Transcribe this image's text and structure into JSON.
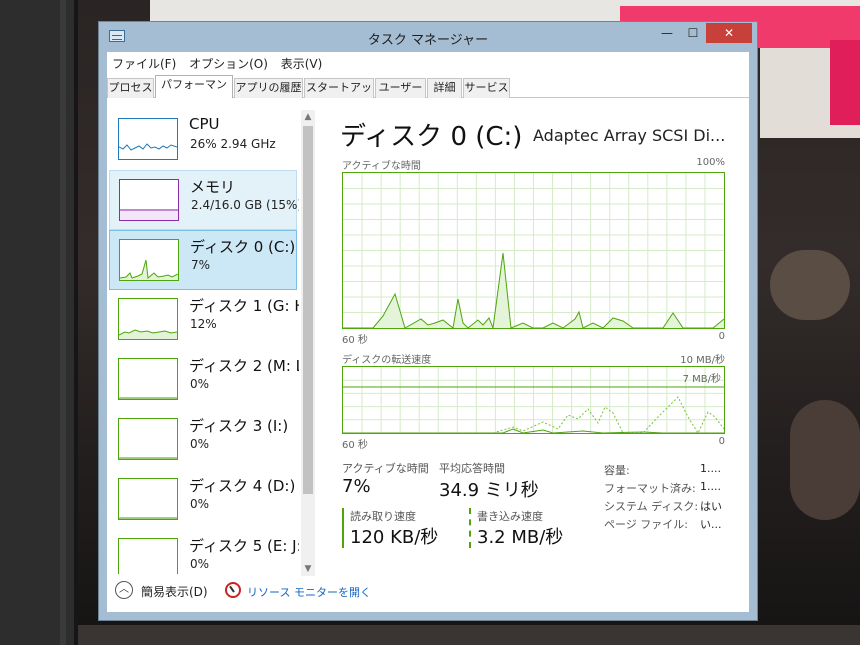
{
  "window": {
    "title": "タスク マネージャー",
    "controls": {
      "minimize": "—",
      "maximize": "☐",
      "close": "✕"
    }
  },
  "menu": [
    "ファイル(F)",
    "オプション(O)",
    "表示(V)"
  ],
  "tabs": [
    "プロセス",
    "パフォーマンス",
    "アプリの履歴",
    "スタートアップ",
    "ユーザー",
    "詳細",
    "サービス"
  ],
  "active_tab": "パフォーマンス",
  "sidebar": {
    "items": [
      {
        "name": "CPU",
        "value": "26% 2.94 GHz",
        "color": "#1e7ab7",
        "state": "normal"
      },
      {
        "name": "メモリ",
        "value": "2.4/16.0 GB (15%)",
        "color": "#8b2da8",
        "state": "hover"
      },
      {
        "name": "ディスク 0 (C:)",
        "value": "7%",
        "color": "#4da60c",
        "state": "selected"
      },
      {
        "name": "ディスク 1 (G: H",
        "value": "12%",
        "color": "#4da60c",
        "state": "normal"
      },
      {
        "name": "ディスク 2 (M: L:",
        "value": "0%",
        "color": "#4da60c",
        "state": "normal"
      },
      {
        "name": "ディスク 3 (I:)",
        "value": "0%",
        "color": "#4da60c",
        "state": "normal"
      },
      {
        "name": "ディスク 4 (D:)",
        "value": "0%",
        "color": "#4da60c",
        "state": "normal"
      },
      {
        "name": "ディスク 5 (E: J:",
        "value": "0%",
        "color": "#4da60c",
        "state": "normal"
      }
    ],
    "scroll": {
      "up": "▲",
      "down": "▼"
    }
  },
  "detail": {
    "title": "ディスク 0 (C:)",
    "model": "Adaptec Array SCSI Di...",
    "graph1": {
      "label": "アクティブな時間",
      "max_label": "100%",
      "time_left": "60 秒",
      "time_right": "0",
      "line_color": "#4da60c"
    },
    "graph2": {
      "label": "ディスクの転送速度",
      "max_label": "10 MB/秒",
      "ref_label": "7 MB/秒",
      "time_left": "60 秒",
      "time_right": "0"
    },
    "stats": {
      "active_time_label": "アクティブな時間",
      "active_time_value": "7%",
      "avg_response_label": "平均応答時間",
      "avg_response_value": "34.9 ミリ秒",
      "read_speed_label": "読み取り速度",
      "read_speed_value": "120 KB/秒",
      "write_speed_label": "書き込み速度",
      "write_speed_value": "3.2 MB/秒"
    },
    "properties": [
      {
        "label": "容量:",
        "value": "1...."
      },
      {
        "label": "フォーマット済み:",
        "value": "1...."
      },
      {
        "label": "システム ディスク:",
        "value": "はい"
      },
      {
        "label": "ページ ファイル:",
        "value": "い..."
      }
    ]
  },
  "bottom": {
    "collapse_icon": "︿",
    "collapse_label": "簡易表示(D)",
    "resource_monitor_link": "リソース モニターを開く"
  }
}
